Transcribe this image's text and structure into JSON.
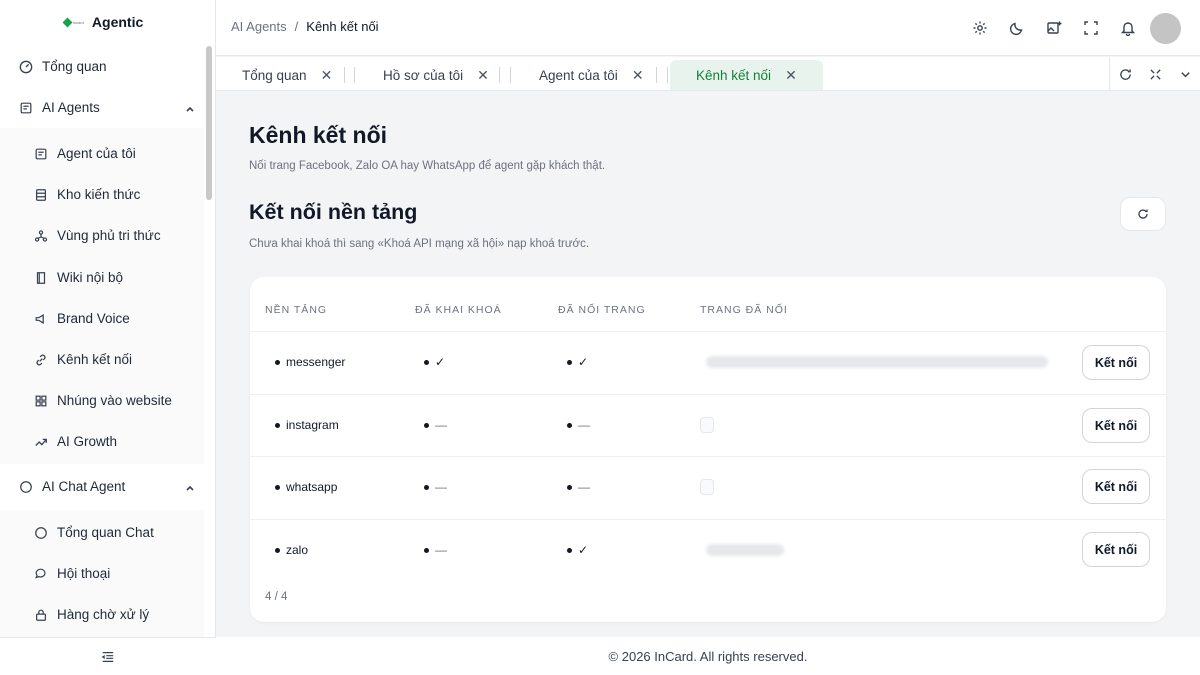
{
  "app": {
    "name": "Agentic",
    "logo_small": "incard"
  },
  "sidebar": {
    "items": [
      {
        "label": "Tổng quan",
        "icon": "gauge-icon"
      },
      {
        "label": "AI Agents",
        "icon": "robot-icon",
        "group": true
      },
      {
        "label": "Agent của tôi",
        "icon": "robot-icon"
      },
      {
        "label": "Kho kiến thức",
        "icon": "database-icon"
      },
      {
        "label": "Vùng phủ tri thức",
        "icon": "network-icon"
      },
      {
        "label": "Wiki nội bộ",
        "icon": "book-icon"
      },
      {
        "label": "Brand Voice",
        "icon": "megaphone-icon"
      },
      {
        "label": "Kênh kết nối",
        "icon": "link-icon"
      },
      {
        "label": "Nhúng vào website",
        "icon": "grid-icon"
      },
      {
        "label": "AI Growth",
        "icon": "trend-icon"
      },
      {
        "label": "AI Chat Agent",
        "icon": "chat-icon",
        "group": true
      },
      {
        "label": "Tổng quan Chat",
        "icon": "chat-icon"
      },
      {
        "label": "Hội thoại",
        "icon": "chat-bubbles-icon"
      },
      {
        "label": "Hàng chờ xử lý",
        "icon": "lock-icon"
      }
    ]
  },
  "header": {
    "breadcrumb": [
      "AI Agents",
      "/",
      "Kênh kết nối"
    ]
  },
  "tabs": [
    {
      "label": "Tổng quan",
      "close": "✕"
    },
    {
      "label": "Hồ sơ của tôi",
      "close": "✕"
    },
    {
      "label": "Agent của tôi",
      "close": "✕"
    },
    {
      "label": "Kênh kết nối",
      "close": "✕",
      "active": true
    }
  ],
  "page": {
    "title": "Kênh kết nối",
    "subtitle": "Nối trang Facebook, Zalo OA hay WhatsApp để agent gặp khách thật.",
    "section_title": "Kết nối nền tảng",
    "section_subtitle": "Chưa khai khoá thì sang «Khoá API mạng xã hội» nạp khoá trước."
  },
  "table": {
    "headers": [
      "NỀN TẢNG",
      "ĐÃ KHAI KHOÁ",
      "ĐÃ NỐI TRANG",
      "TRANG ĐÃ NỐI"
    ],
    "rows": [
      {
        "platform": "messenger",
        "key": "✓",
        "page": "✓",
        "page_state": "blurred-long",
        "action": "Kết nối"
      },
      {
        "platform": "instagram",
        "key": "—",
        "page": "—",
        "page_state": "empty",
        "action": "Kết nối"
      },
      {
        "platform": "whatsapp",
        "key": "—",
        "page": "—",
        "page_state": "empty",
        "action": "Kết nối"
      },
      {
        "platform": "zalo",
        "key": "—",
        "page": "✓",
        "page_state": "blurred-short",
        "action": "Kết nối"
      }
    ],
    "count": "4 / 4"
  },
  "footer": {
    "text": "© 2026 InCard. All rights reserved."
  },
  "colors": {
    "accent": "#15803d",
    "active_tab_bg": "#e7f3ec"
  }
}
